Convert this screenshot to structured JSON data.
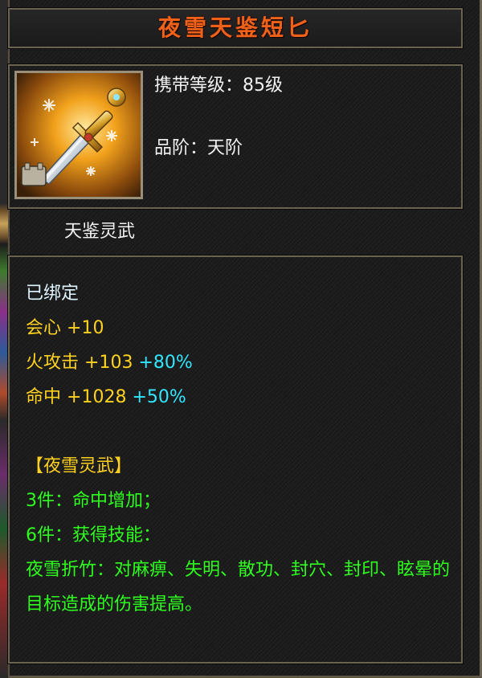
{
  "item": {
    "name": "夜雪天鉴短匕",
    "icon": "dagger-icon",
    "carry_level": "携带等级：85级",
    "grade": "品阶：天阶",
    "series": "天鉴灵武"
  },
  "stats": {
    "bound": "已绑定",
    "crit": {
      "label": "会心",
      "value": "+10"
    },
    "fire_attack": {
      "label": "火攻击",
      "value": "+103",
      "bonus": "+80%"
    },
    "hit": {
      "label": "命中",
      "value": "+1028",
      "bonus": "+50%"
    }
  },
  "set": {
    "name": "【夜雪灵武】",
    "bonus3": "3件：命中增加；",
    "bonus6": "6件：获得技能：",
    "skill": "夜雪折竹：对麻痹、失明、散功、封穴、封印、眩晕的目标造成的伤害提高。"
  },
  "colors": {
    "title": "#f0611a",
    "stat_yellow": "#ffd21f",
    "bonus_cyan": "#31e7ff",
    "set_green": "#2eff1f",
    "bound_white": "#dff6ff"
  }
}
